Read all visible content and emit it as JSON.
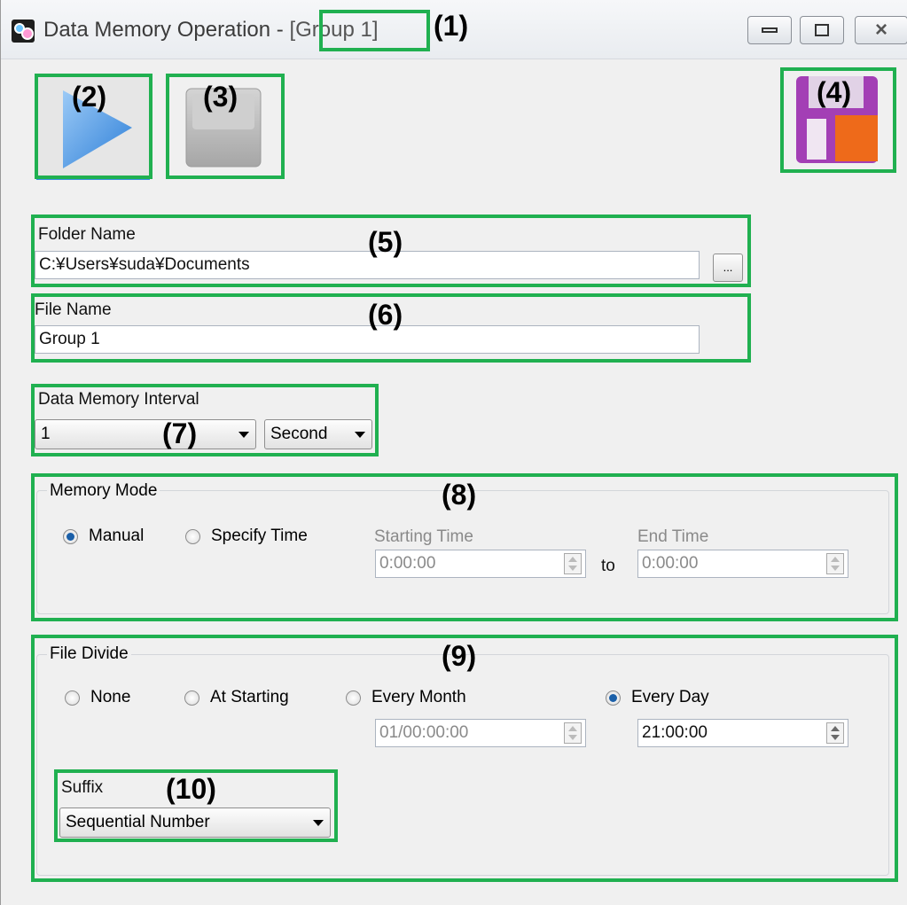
{
  "window": {
    "title_prefix": "Data Memory Operation - ",
    "title_group": "[Group 1]",
    "controls": {
      "minimize": "minimize-icon",
      "maximize": "maximize-icon",
      "close": "close-icon"
    }
  },
  "toolbar": {
    "start_icon": "play-icon",
    "stop_icon": "stop-icon",
    "save_icon": "floppy-disk-icon"
  },
  "folder": {
    "label": "Folder Name",
    "value": "C:¥Users¥suda¥Documents",
    "browse": "..."
  },
  "file": {
    "label": "File Name",
    "value": "Group 1"
  },
  "interval": {
    "label": "Data Memory Interval",
    "value": "1",
    "unit": "Second"
  },
  "memory_mode": {
    "title": "Memory Mode",
    "options": [
      {
        "label": "Manual",
        "selected": true
      },
      {
        "label": "Specify Time",
        "selected": false
      }
    ],
    "start_label": "Starting Time",
    "start_value": "0:00:00",
    "to": "to",
    "end_label": "End Time",
    "end_value": "0:00:00"
  },
  "file_divide": {
    "title": "File Divide",
    "options": [
      {
        "label": "None",
        "selected": false
      },
      {
        "label": "At Starting",
        "selected": false
      },
      {
        "label": "Every Month",
        "selected": false
      },
      {
        "label": "Every Day",
        "selected": true
      }
    ],
    "month_value": "01/00:00:00",
    "day_value": "21:00:00"
  },
  "suffix": {
    "label": "Suffix",
    "value": "Sequential Number"
  },
  "callouts": [
    "(1)",
    "(2)",
    "(3)",
    "(4)",
    "(5)",
    "(6)",
    "(7)",
    "(8)",
    "(9)",
    "(10)"
  ],
  "colors": {
    "highlight": "#20b050",
    "play": "#3a8fe0",
    "selected_radio": "#1a5fa8"
  }
}
